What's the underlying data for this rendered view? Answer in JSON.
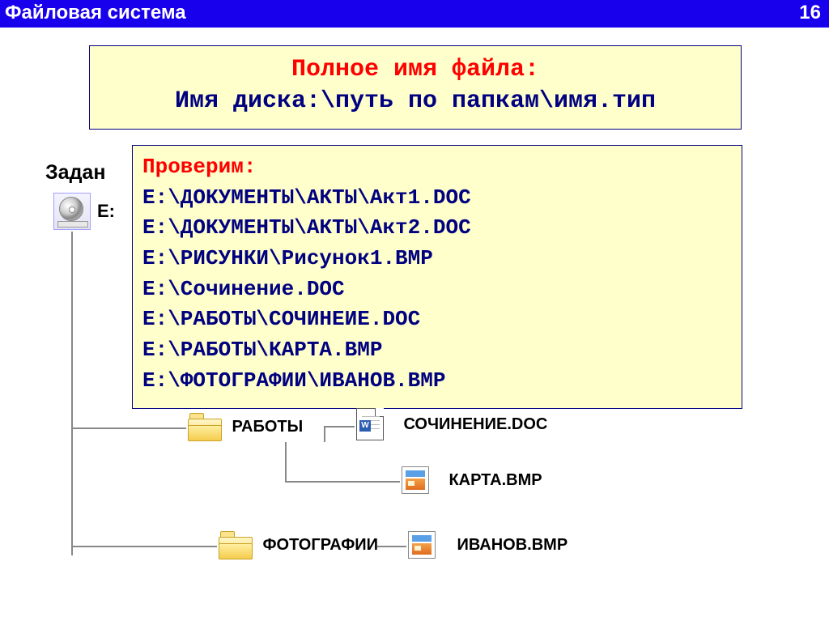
{
  "header": {
    "title": "Файловая система",
    "page_number": "16"
  },
  "title_box": {
    "line1": "Полное имя файла:",
    "line2": "Имя диска:\\путь по папкам\\имя.тип"
  },
  "task_label": "Задан",
  "drive_label": "E:",
  "check_box": {
    "lead": "Проверим:",
    "paths": [
      "E:\\ДОКУМЕНТЫ\\АКТЫ\\Акт1.DOC",
      "E:\\ДОКУМЕНТЫ\\АКТЫ\\Акт2.DOC",
      "E:\\РИСУНКИ\\Рисунок1.BMP",
      "E:\\Сочинение.DOC",
      "E:\\РАБОТЫ\\СОЧИНЕИЕ.DOC",
      "E:\\РАБОТЫ\\КАРТА.BMP",
      "E:\\ФОТОГРАФИИ\\ИВАНОВ.BMP"
    ]
  },
  "tree": {
    "folder1": "РАБОТЫ",
    "folder2": "ФОТОГРАФИИ",
    "file1": "СОЧИНЕНИЕ.DOC",
    "file2": "КАРТА.BMP",
    "file3": "ИВАНОВ.BMP"
  }
}
